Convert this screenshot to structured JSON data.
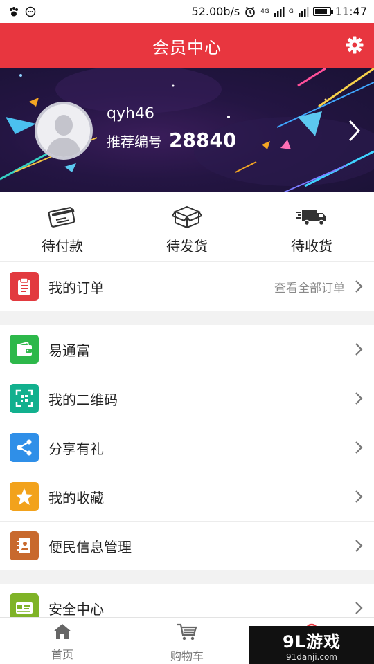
{
  "status_bar": {
    "speed": "52.00b/s",
    "net_4g": "4G",
    "net_g": "G",
    "time": "11:47",
    "battery_level": 0.85
  },
  "header": {
    "title": "会员中心",
    "settings_icon": "gear-icon"
  },
  "profile": {
    "username": "qyh46",
    "referral_label": "推荐编号",
    "referral_code": "28840"
  },
  "order_status": [
    {
      "label": "待付款",
      "icon": "card-icon"
    },
    {
      "label": "待发货",
      "icon": "box-icon"
    },
    {
      "label": "待收货",
      "icon": "truck-icon"
    }
  ],
  "my_orders": {
    "label": "我的订单",
    "view_all": "查看全部订单",
    "icon_color": "#e23a3f"
  },
  "menu": [
    {
      "label": "易通富",
      "icon": "wallet-icon",
      "color": "#2db84a"
    },
    {
      "label": "我的二维码",
      "icon": "qr-code-icon",
      "color": "#12b08e"
    },
    {
      "label": "分享有礼",
      "icon": "share-icon",
      "color": "#2f8fe8"
    },
    {
      "label": "我的收藏",
      "icon": "star-icon",
      "color": "#f2a21c"
    },
    {
      "label": "便民信息管理",
      "icon": "contact-book-icon",
      "color": "#c8692d"
    },
    {
      "label": "安全中心",
      "icon": "security-card-icon",
      "color": "#7fb327"
    }
  ],
  "bottom_nav": [
    {
      "label": "首页",
      "icon": "home-icon"
    },
    {
      "label": "购物车",
      "icon": "cart-icon"
    }
  ],
  "watermark": {
    "main": "9L游戏",
    "sub": "91danji.com"
  },
  "colors": {
    "brand_red": "#e8363f",
    "banner_bg": "#241543"
  }
}
